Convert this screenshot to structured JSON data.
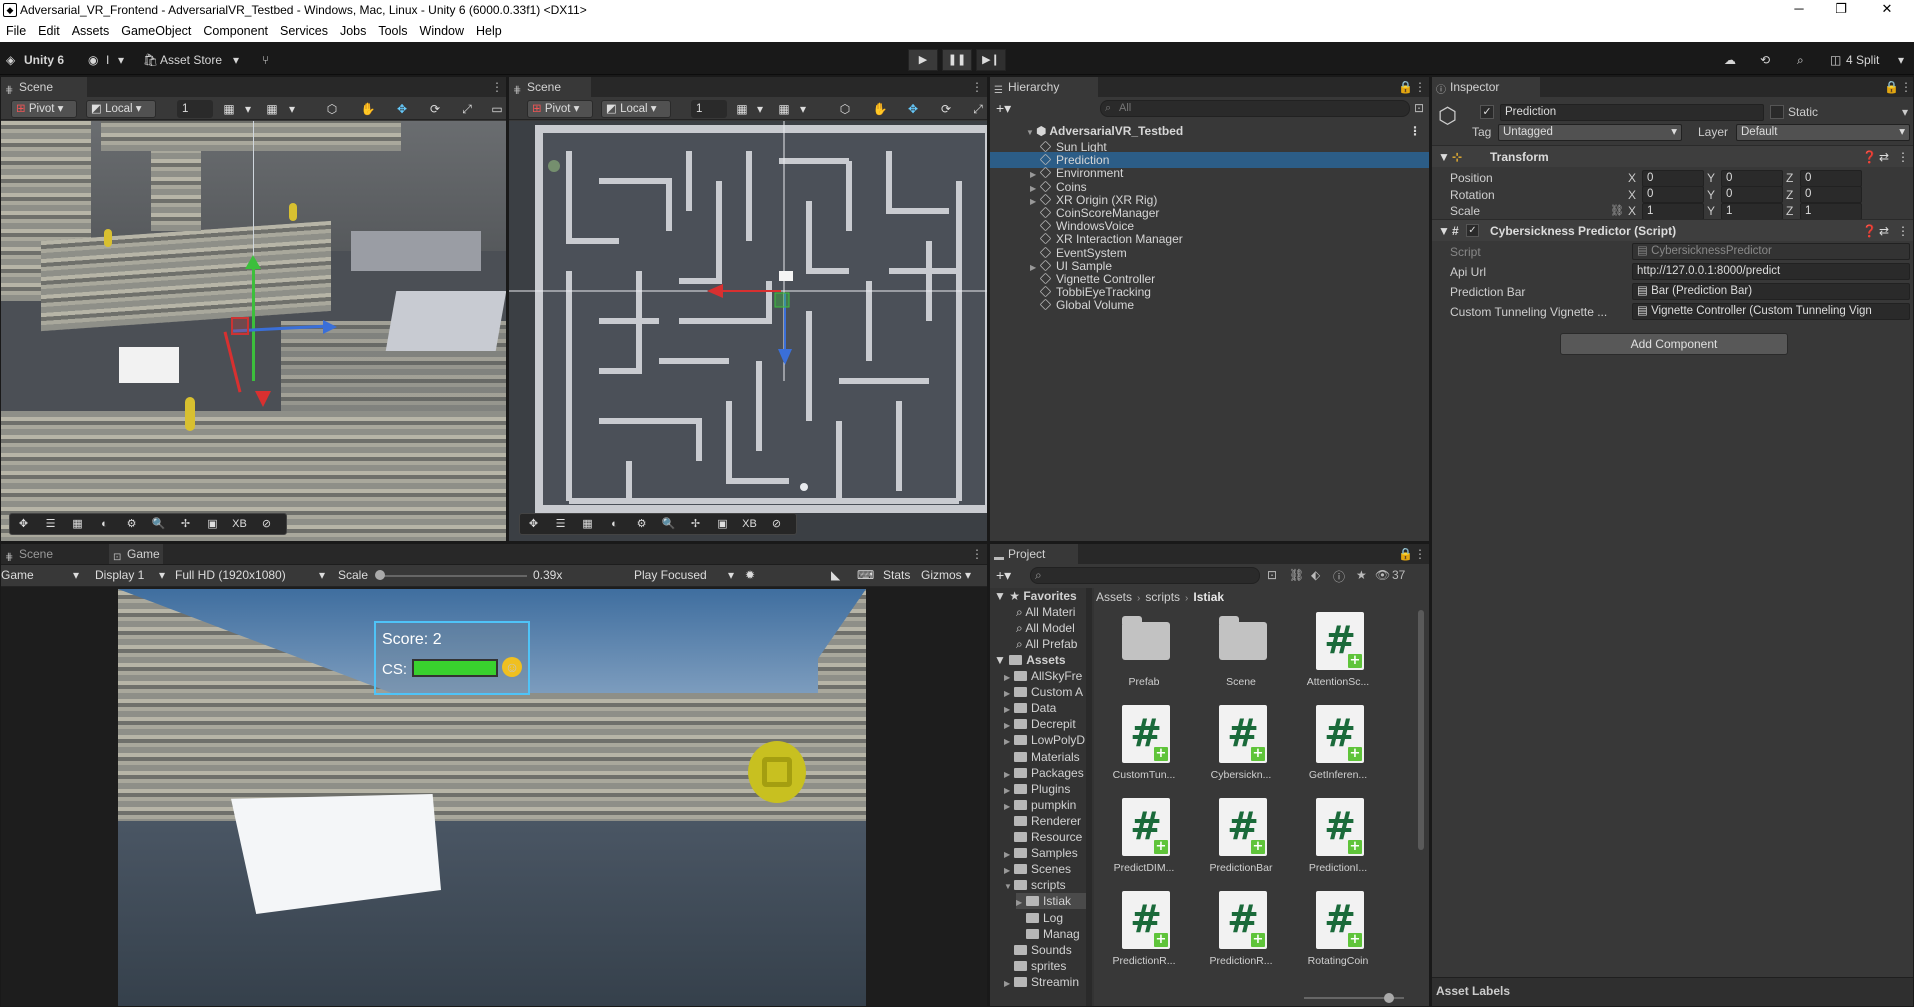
{
  "window": {
    "title": "Adversarial_VR_Frontend - AdversarialVR_Testbed - Windows, Mac, Linux - Unity 6 (6000.0.33f1) <DX11>",
    "minimize": "─",
    "maximize": "❐",
    "close": "✕"
  },
  "menu": [
    "File",
    "Edit",
    "Assets",
    "GameObject",
    "Component",
    "Services",
    "Jobs",
    "Tools",
    "Window",
    "Help"
  ],
  "toolbar": {
    "unity_label": "Unity 6",
    "account": "I",
    "asset_store": "Asset Store",
    "layout": "4 Split"
  },
  "scene1": {
    "tab": "Scene",
    "pivot": "Pivot",
    "local": "Local",
    "grid_value": "1"
  },
  "scene2": {
    "tab": "Scene",
    "pivot": "Pivot",
    "local": "Local",
    "grid_value": "1"
  },
  "scene_overlay": [
    "✥",
    "☰",
    "▦",
    "◐",
    "⚙",
    "🔍",
    "✢",
    "▣",
    "XB",
    "⊘"
  ],
  "game": {
    "tab_scene": "Scene",
    "tab_game": "Game",
    "mode": "Game",
    "display": "Display 1",
    "resolution": "Full HD (1920x1080)",
    "scale_label": "Scale",
    "scale_value": "0.39x",
    "play_focused": "Play Focused",
    "stats": "Stats",
    "gizmos": "Gizmos",
    "hud_score": "Score: 2",
    "hud_cs": "CS:",
    "hud_cs_level": 1.0
  },
  "hierarchy": {
    "tab": "Hierarchy",
    "search_placeholder": "All",
    "scene": "AdversarialVR_Testbed",
    "items": [
      {
        "name": "Sun Light",
        "arrow": false,
        "selected": false
      },
      {
        "name": "Prediction",
        "arrow": false,
        "selected": true
      },
      {
        "name": "Environment",
        "arrow": true,
        "selected": false
      },
      {
        "name": "Coins",
        "arrow": true,
        "selected": false
      },
      {
        "name": "XR Origin (XR Rig)",
        "arrow": true,
        "selected": false
      },
      {
        "name": "CoinScoreManager",
        "arrow": false,
        "selected": false
      },
      {
        "name": "WindowsVoice",
        "arrow": false,
        "selected": false
      },
      {
        "name": "XR Interaction Manager",
        "arrow": false,
        "selected": false
      },
      {
        "name": "EventSystem",
        "arrow": false,
        "selected": false
      },
      {
        "name": "UI Sample",
        "arrow": true,
        "selected": false
      },
      {
        "name": "Vignette Controller",
        "arrow": false,
        "selected": false
      },
      {
        "name": "TobbiEyeTracking",
        "arrow": false,
        "selected": false
      },
      {
        "name": "Global Volume",
        "arrow": false,
        "selected": false
      }
    ]
  },
  "inspector": {
    "tab": "Inspector",
    "object_name": "Prediction",
    "static_label": "Static",
    "tag_label": "Tag",
    "tag_value": "Untagged",
    "layer_label": "Layer",
    "layer_value": "Default",
    "transform": {
      "title": "Transform",
      "position_label": "Position",
      "rotation_label": "Rotation",
      "scale_label": "Scale",
      "position": [
        "0",
        "0",
        "0"
      ],
      "rotation": [
        "0",
        "0",
        "0"
      ],
      "scale": [
        "1",
        "1",
        "1"
      ],
      "axes": [
        "X",
        "Y",
        "Z"
      ]
    },
    "script": {
      "title": "Cybersickness Predictor (Script)",
      "script_label": "Script",
      "script_value": "CybersicknessPredictor",
      "api_label": "Api Url",
      "api_value": "http://127.0.0.1:8000/predict",
      "bar_label": "Prediction Bar",
      "bar_value": "Bar (Prediction Bar)",
      "vig_label": "Custom Tunneling Vignette ...",
      "vig_value": "Vignette Controller (Custom Tunneling Vign"
    },
    "add_component": "Add Component",
    "asset_labels": "Asset Labels"
  },
  "project": {
    "tab": "Project",
    "count": "37",
    "breadcrumb": [
      "Assets",
      "scripts",
      "Istiak"
    ],
    "favorites_label": "Favorites",
    "favorites": [
      "All Materi",
      "All Model",
      "All Prefab"
    ],
    "assets_label": "Assets",
    "tree": [
      {
        "name": "AllSkyFre",
        "indent": 1,
        "arrow": "▶"
      },
      {
        "name": "Custom A",
        "indent": 1,
        "arrow": "▶"
      },
      {
        "name": "Data",
        "indent": 1,
        "arrow": "▶"
      },
      {
        "name": "Decrepit",
        "indent": 1,
        "arrow": "▶"
      },
      {
        "name": "LowPolyD",
        "indent": 1,
        "arrow": "▶"
      },
      {
        "name": "Materials",
        "indent": 1,
        "arrow": ""
      },
      {
        "name": "Packages",
        "indent": 1,
        "arrow": "▶"
      },
      {
        "name": "Plugins",
        "indent": 1,
        "arrow": "▶"
      },
      {
        "name": "pumpkin",
        "indent": 1,
        "arrow": "▶"
      },
      {
        "name": "Renderer",
        "indent": 1,
        "arrow": ""
      },
      {
        "name": "Resource",
        "indent": 1,
        "arrow": ""
      },
      {
        "name": "Samples",
        "indent": 1,
        "arrow": "▶"
      },
      {
        "name": "Scenes",
        "indent": 1,
        "arrow": "▶"
      },
      {
        "name": "scripts",
        "indent": 1,
        "arrow": "▼"
      },
      {
        "name": "Istiak",
        "indent": 2,
        "arrow": "▶"
      },
      {
        "name": "Log",
        "indent": 2,
        "arrow": ""
      },
      {
        "name": "Manag",
        "indent": 2,
        "arrow": ""
      },
      {
        "name": "Sounds",
        "indent": 1,
        "arrow": ""
      },
      {
        "name": "sprites",
        "indent": 1,
        "arrow": ""
      },
      {
        "name": "Streamin",
        "indent": 1,
        "arrow": "▶"
      }
    ],
    "assets": [
      {
        "name": "Prefab",
        "kind": "folder"
      },
      {
        "name": "Scene",
        "kind": "folder"
      },
      {
        "name": "AttentionSc...",
        "kind": "script"
      },
      {
        "name": "CustomTun...",
        "kind": "script"
      },
      {
        "name": "Cybersickn...",
        "kind": "script"
      },
      {
        "name": "GetInferen...",
        "kind": "script"
      },
      {
        "name": "PredictDIM...",
        "kind": "script"
      },
      {
        "name": "PredictionBar",
        "kind": "script"
      },
      {
        "name": "PredictionI...",
        "kind": "script"
      },
      {
        "name": "PredictionR...",
        "kind": "script"
      },
      {
        "name": "PredictionR...",
        "kind": "script"
      },
      {
        "name": "RotatingCoin",
        "kind": "script"
      }
    ]
  }
}
